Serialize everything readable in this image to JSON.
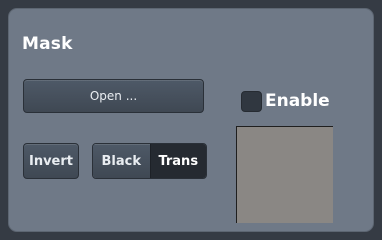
{
  "mask_panel": {
    "title": "Mask",
    "open_button_label": "Open ...",
    "enable_label": "Enable",
    "enable_checked": false,
    "invert_button_label": "Invert",
    "mode_options": [
      "Black",
      "Trans"
    ],
    "selected_mode": "Trans",
    "preview_color": "#8a8784"
  }
}
